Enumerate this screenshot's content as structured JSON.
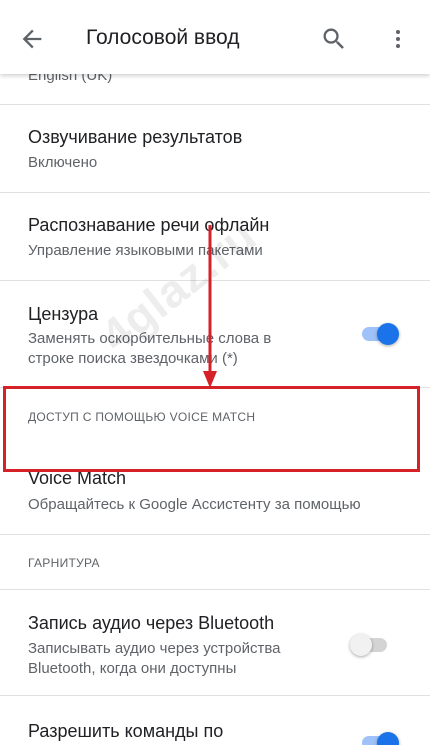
{
  "appbar": {
    "title": "Голосовой ввод"
  },
  "rows": {
    "language_value": "English (UK)",
    "speak_results": {
      "title": "Озвучивание результатов",
      "subtitle": "Включено"
    },
    "offline": {
      "title": "Распознавание речи офлайн",
      "subtitle": "Управление языковыми пакетами"
    },
    "censor": {
      "title": "Цензура",
      "subtitle_line1": "Заменять оскорбительные слова в",
      "subtitle_line2": "строке поиска звездочками (*)",
      "enabled": true
    },
    "voice_match_section": "ДОСТУП С ПОМОЩЬЮ VOICE MATCH",
    "voice_match": {
      "title": "Voice Match",
      "subtitle": "Обращайтесь к Google Ассистенту за помощью"
    },
    "headset_section": "ГАРНИТУРА",
    "bt_audio": {
      "title": "Запись аудио через Bluetooth",
      "subtitle_line1": "Записывать аудио через устройства",
      "subtitle_line2": "Bluetooth, когда они доступны",
      "enabled": false
    },
    "allow_commands": {
      "title": "Разрешить команды по",
      "enabled": true
    }
  },
  "watermark": "4glaz.ru",
  "colors": {
    "accent": "#1a73e8",
    "highlight": "#d52128"
  },
  "icons": {
    "back": "arrow-back-icon",
    "search": "search-icon",
    "more": "more-vert-icon"
  }
}
